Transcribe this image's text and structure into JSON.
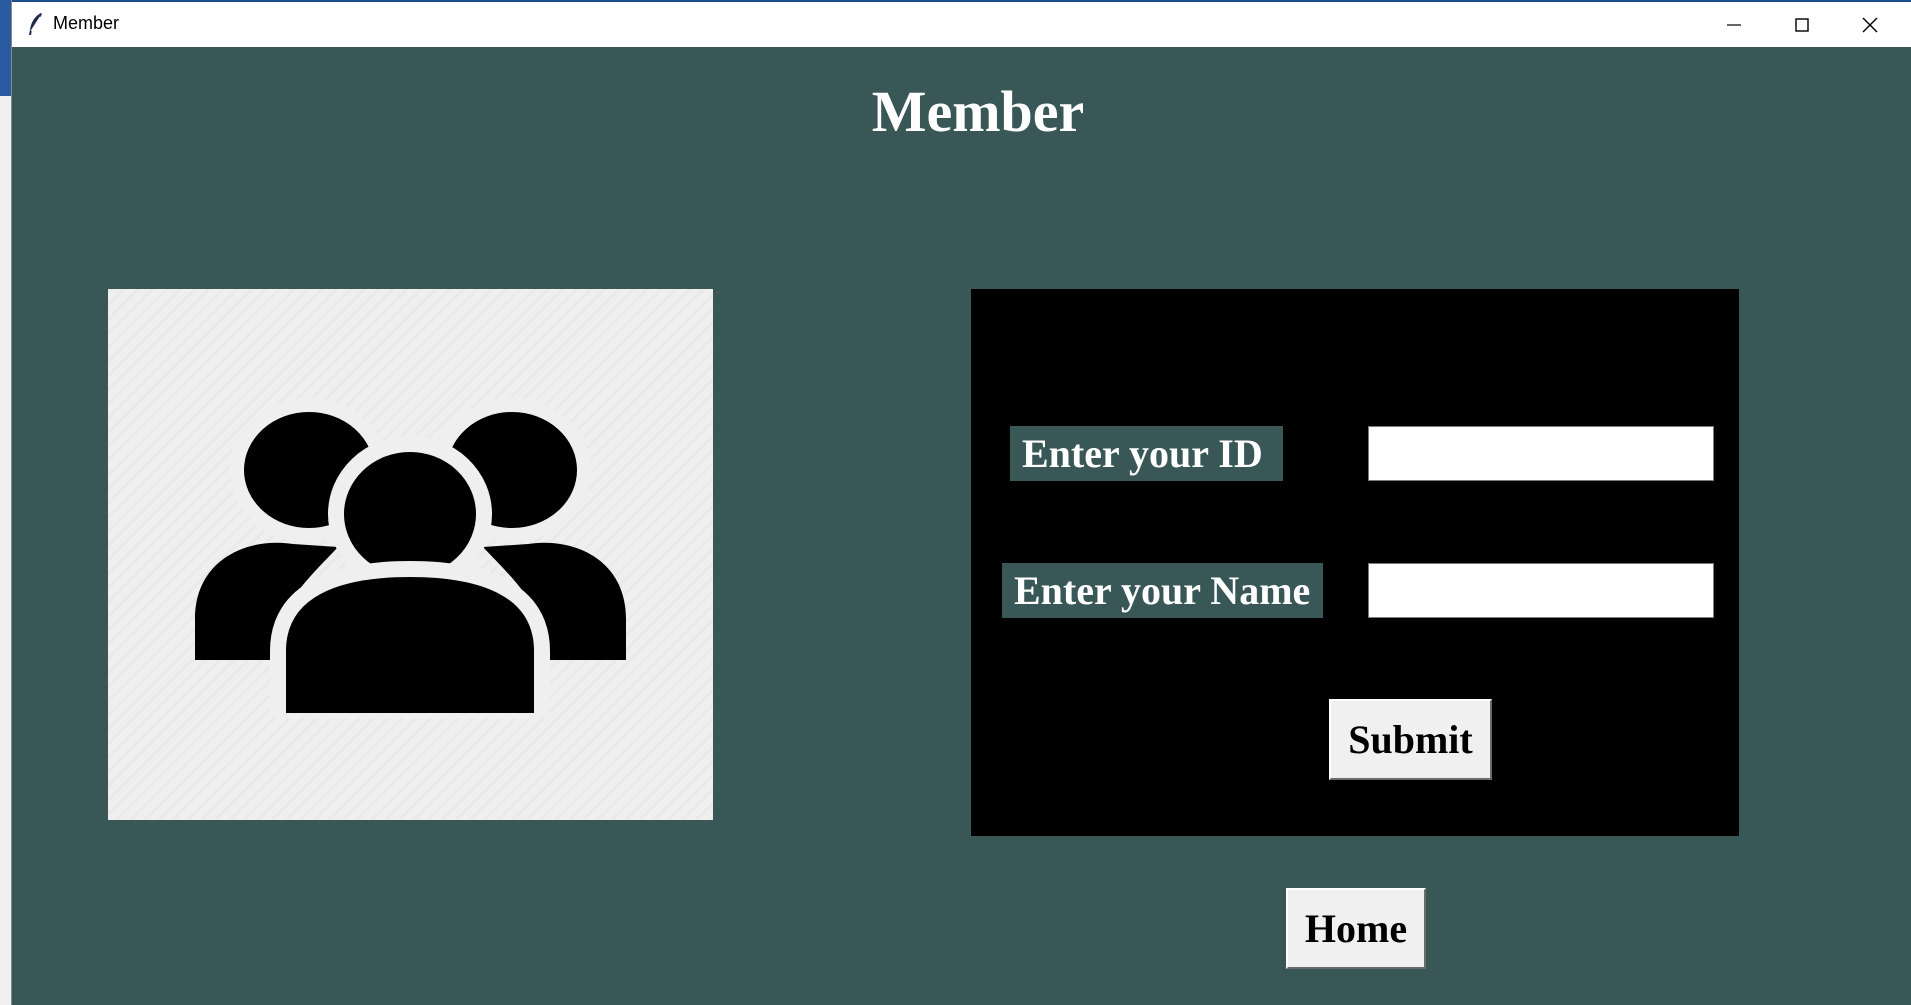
{
  "window": {
    "title": "Member",
    "app_icon": "feather-icon",
    "controls": [
      "minimize-icon",
      "maximize-icon",
      "close-icon"
    ]
  },
  "page": {
    "heading": "Member",
    "image_icon": "users-group-icon"
  },
  "form": {
    "id_label": "Enter your ID",
    "id_value": "",
    "name_label": "Enter your Name",
    "name_value": "",
    "submit_label": "Submit"
  },
  "navigation": {
    "home_label": "Home"
  },
  "colors": {
    "window_background": "#395757",
    "form_background": "#000000",
    "label_background": "#395757",
    "text": "#ffffff",
    "button_face": "#f0f0f0"
  }
}
